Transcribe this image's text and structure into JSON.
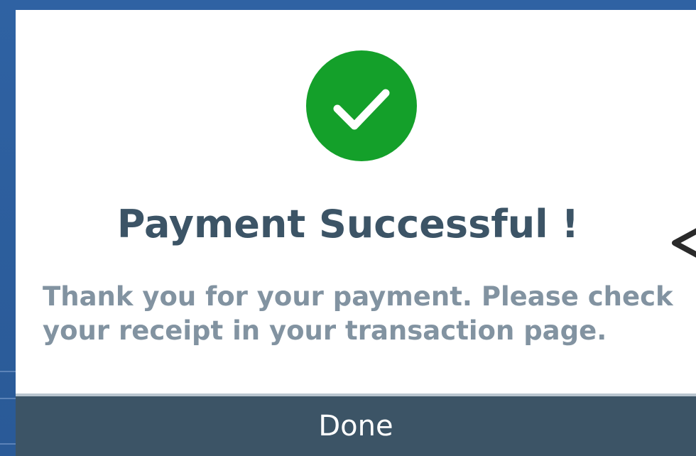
{
  "dialog": {
    "status_icon": "checkmark-icon",
    "title": "Payment Successful !",
    "message": "Thank you for your payment. Please check your receipt in your transaction page.",
    "done_label": "Done"
  },
  "side_control": {
    "icon": "chevron-left-icon"
  },
  "colors": {
    "success": "#14a02a",
    "title": "#3c5466",
    "message": "#8293a1",
    "button_bg": "#3c5466",
    "backdrop": "#2f62a3"
  }
}
